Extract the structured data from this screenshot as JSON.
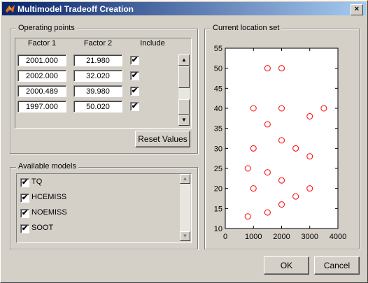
{
  "window": {
    "title": "Multimodel Tradeoff Creation",
    "icon": "matlab-icon",
    "close_glyph": "×"
  },
  "operating_points": {
    "title": "Operating points",
    "columns": [
      "Factor 1",
      "Factor 2",
      "Include"
    ],
    "rows": [
      {
        "factor1": "2001.000",
        "factor2": "21.980",
        "include": true
      },
      {
        "factor1": "2002.000",
        "factor2": "32.020",
        "include": true
      },
      {
        "factor1": "2000.489",
        "factor2": "39.980",
        "include": true
      },
      {
        "factor1": "1997.000",
        "factor2": "50.020",
        "include": true
      }
    ],
    "check_glyph": "✔",
    "reset_label": "Reset Values",
    "scroll_up_glyph": "▲",
    "scroll_down_glyph": "▼"
  },
  "available_models": {
    "title": "Available models",
    "items": [
      {
        "label": "TQ",
        "checked": true
      },
      {
        "label": "HCEMISS",
        "checked": true
      },
      {
        "label": "NOEMISS",
        "checked": true
      },
      {
        "label": "SOOT",
        "checked": true
      }
    ],
    "scroll_up_glyph": "▲",
    "scroll_down_glyph": "▼"
  },
  "location_set": {
    "title": "Current location set"
  },
  "buttons": {
    "ok": "OK",
    "cancel": "Cancel"
  },
  "chart_data": {
    "type": "scatter",
    "title": "",
    "xlabel": "",
    "ylabel": "",
    "xlim": [
      0,
      4000
    ],
    "ylim": [
      10,
      55
    ],
    "xticks": [
      0,
      1000,
      2000,
      3000,
      4000
    ],
    "yticks": [
      10,
      15,
      20,
      25,
      30,
      35,
      40,
      45,
      50,
      55
    ],
    "grid": false,
    "marker": "circle",
    "marker_color": "#ff0000",
    "points": [
      {
        "x": 1500,
        "y": 50
      },
      {
        "x": 2000,
        "y": 50
      },
      {
        "x": 1000,
        "y": 40
      },
      {
        "x": 2000,
        "y": 40
      },
      {
        "x": 3500,
        "y": 40
      },
      {
        "x": 3000,
        "y": 38
      },
      {
        "x": 1500,
        "y": 36
      },
      {
        "x": 2000,
        "y": 32
      },
      {
        "x": 1000,
        "y": 30
      },
      {
        "x": 2500,
        "y": 30
      },
      {
        "x": 3000,
        "y": 28
      },
      {
        "x": 800,
        "y": 25
      },
      {
        "x": 1500,
        "y": 24
      },
      {
        "x": 2000,
        "y": 22
      },
      {
        "x": 1000,
        "y": 20
      },
      {
        "x": 3000,
        "y": 20
      },
      {
        "x": 2500,
        "y": 18
      },
      {
        "x": 2000,
        "y": 16
      },
      {
        "x": 1500,
        "y": 14
      },
      {
        "x": 800,
        "y": 13
      }
    ]
  }
}
